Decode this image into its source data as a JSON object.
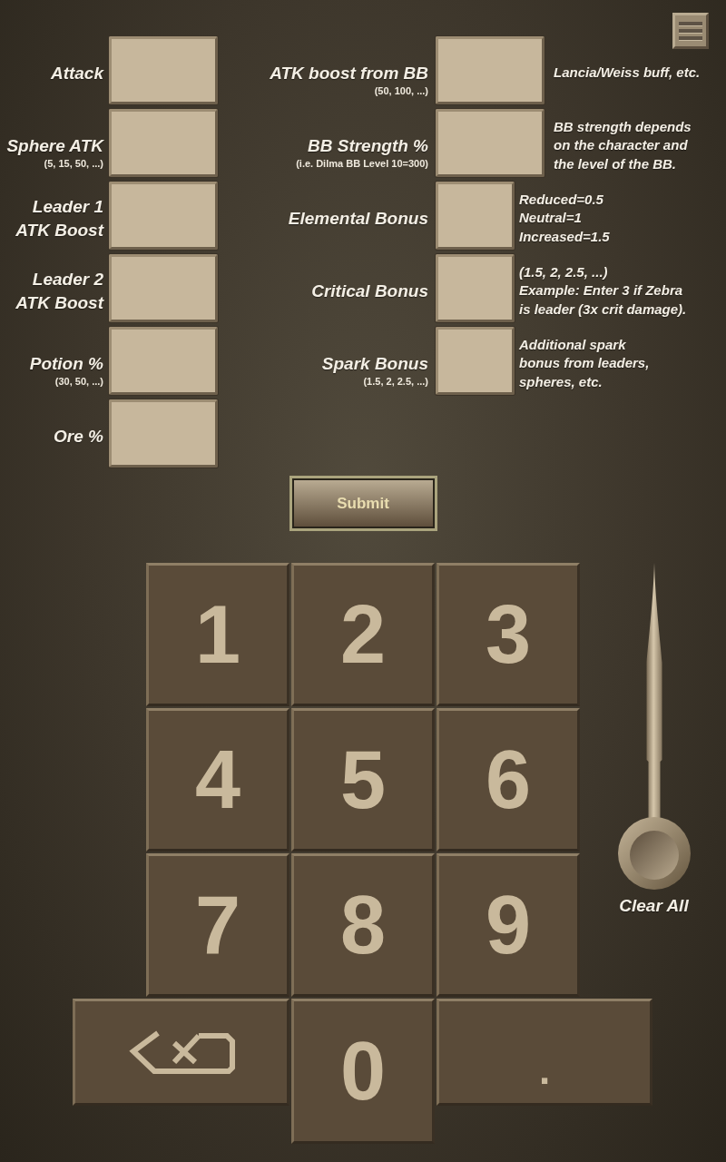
{
  "fields_left": [
    {
      "label": "Attack"
    },
    {
      "label": "Sphere ATK",
      "hint": "(5, 15, 50, ...)"
    },
    {
      "label": "Leader 1\nATK Boost"
    },
    {
      "label": "Leader 2\nATK Boost"
    },
    {
      "label": "Potion %",
      "hint": "(30, 50, ...)"
    },
    {
      "label": "Ore %"
    }
  ],
  "fields_right": [
    {
      "label": "ATK boost from BB",
      "hint": "(50, 100, ...)",
      "note": "Lancia/Weiss buff, etc."
    },
    {
      "label": "BB Strength %",
      "hint": "(i.e. Dilma BB Level 10=300)",
      "note": "BB strength depends\non the character and\nthe level of the BB."
    },
    {
      "label": "Elemental Bonus",
      "note": "Reduced=0.5\nNeutral=1\nIncreased=1.5"
    },
    {
      "label": "Critical Bonus",
      "note": "(1.5, 2, 2.5, ...)\nExample: Enter 3 if Zebra\nis leader (3x crit damage)."
    },
    {
      "label": "Spark Bonus",
      "hint": "(1.5, 2, 2.5, ...)",
      "note": "Additional spark\nbonus from leaders,\nspheres, etc."
    }
  ],
  "submit_button": {
    "label": "Submit"
  },
  "keypad": {
    "keys": [
      {
        "kind": "digit",
        "label": "1"
      },
      {
        "kind": "digit",
        "label": "2"
      },
      {
        "kind": "digit",
        "label": "3"
      },
      {
        "kind": "digit",
        "label": "4"
      },
      {
        "kind": "digit",
        "label": "5"
      },
      {
        "kind": "digit",
        "label": "6"
      },
      {
        "kind": "digit",
        "label": "7"
      },
      {
        "kind": "digit",
        "label": "8"
      },
      {
        "kind": "digit",
        "label": "9"
      },
      {
        "kind": "backspace"
      },
      {
        "kind": "digit",
        "label": "0"
      },
      {
        "kind": "point",
        "label": "."
      }
    ]
  },
  "clear_all": {
    "label": "Clear All"
  }
}
